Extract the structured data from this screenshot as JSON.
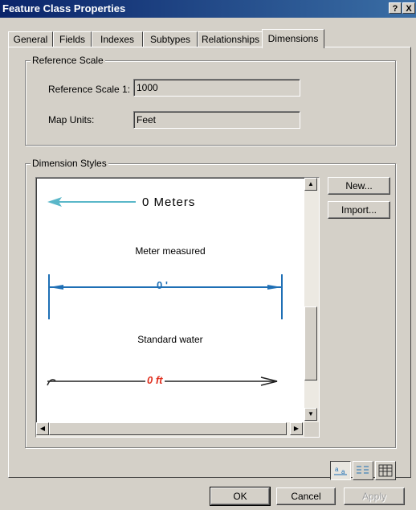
{
  "window": {
    "title": "Feature Class Properties",
    "help_glyph": "?",
    "close_glyph": "X"
  },
  "tabs": [
    {
      "label": "General"
    },
    {
      "label": "Fields"
    },
    {
      "label": "Indexes"
    },
    {
      "label": "Subtypes"
    },
    {
      "label": "Relationships"
    },
    {
      "label": "Dimensions",
      "active": true
    }
  ],
  "reference_scale": {
    "group_label": "Reference Scale",
    "scale_label": "Reference Scale 1:",
    "scale_value": "1000",
    "units_label": "Map Units:",
    "units_value": "Feet"
  },
  "dimension_styles": {
    "group_label": "Dimension Styles",
    "styles": [
      {
        "name": "",
        "sample_text": "0 Meters",
        "color": "#5ab7c9"
      },
      {
        "name": "Meter measured",
        "sample_text": "0 '",
        "color": "#1e6fb5"
      },
      {
        "name": "Standard water",
        "sample_text": "0 ft",
        "color": "#e03020"
      }
    ],
    "new_button": "New...",
    "import_button": "Import...",
    "view_buttons": [
      "preview-view-icon",
      "list-view-icon",
      "detail-view-icon"
    ]
  },
  "footer": {
    "ok": "OK",
    "cancel": "Cancel",
    "apply": "Apply"
  }
}
